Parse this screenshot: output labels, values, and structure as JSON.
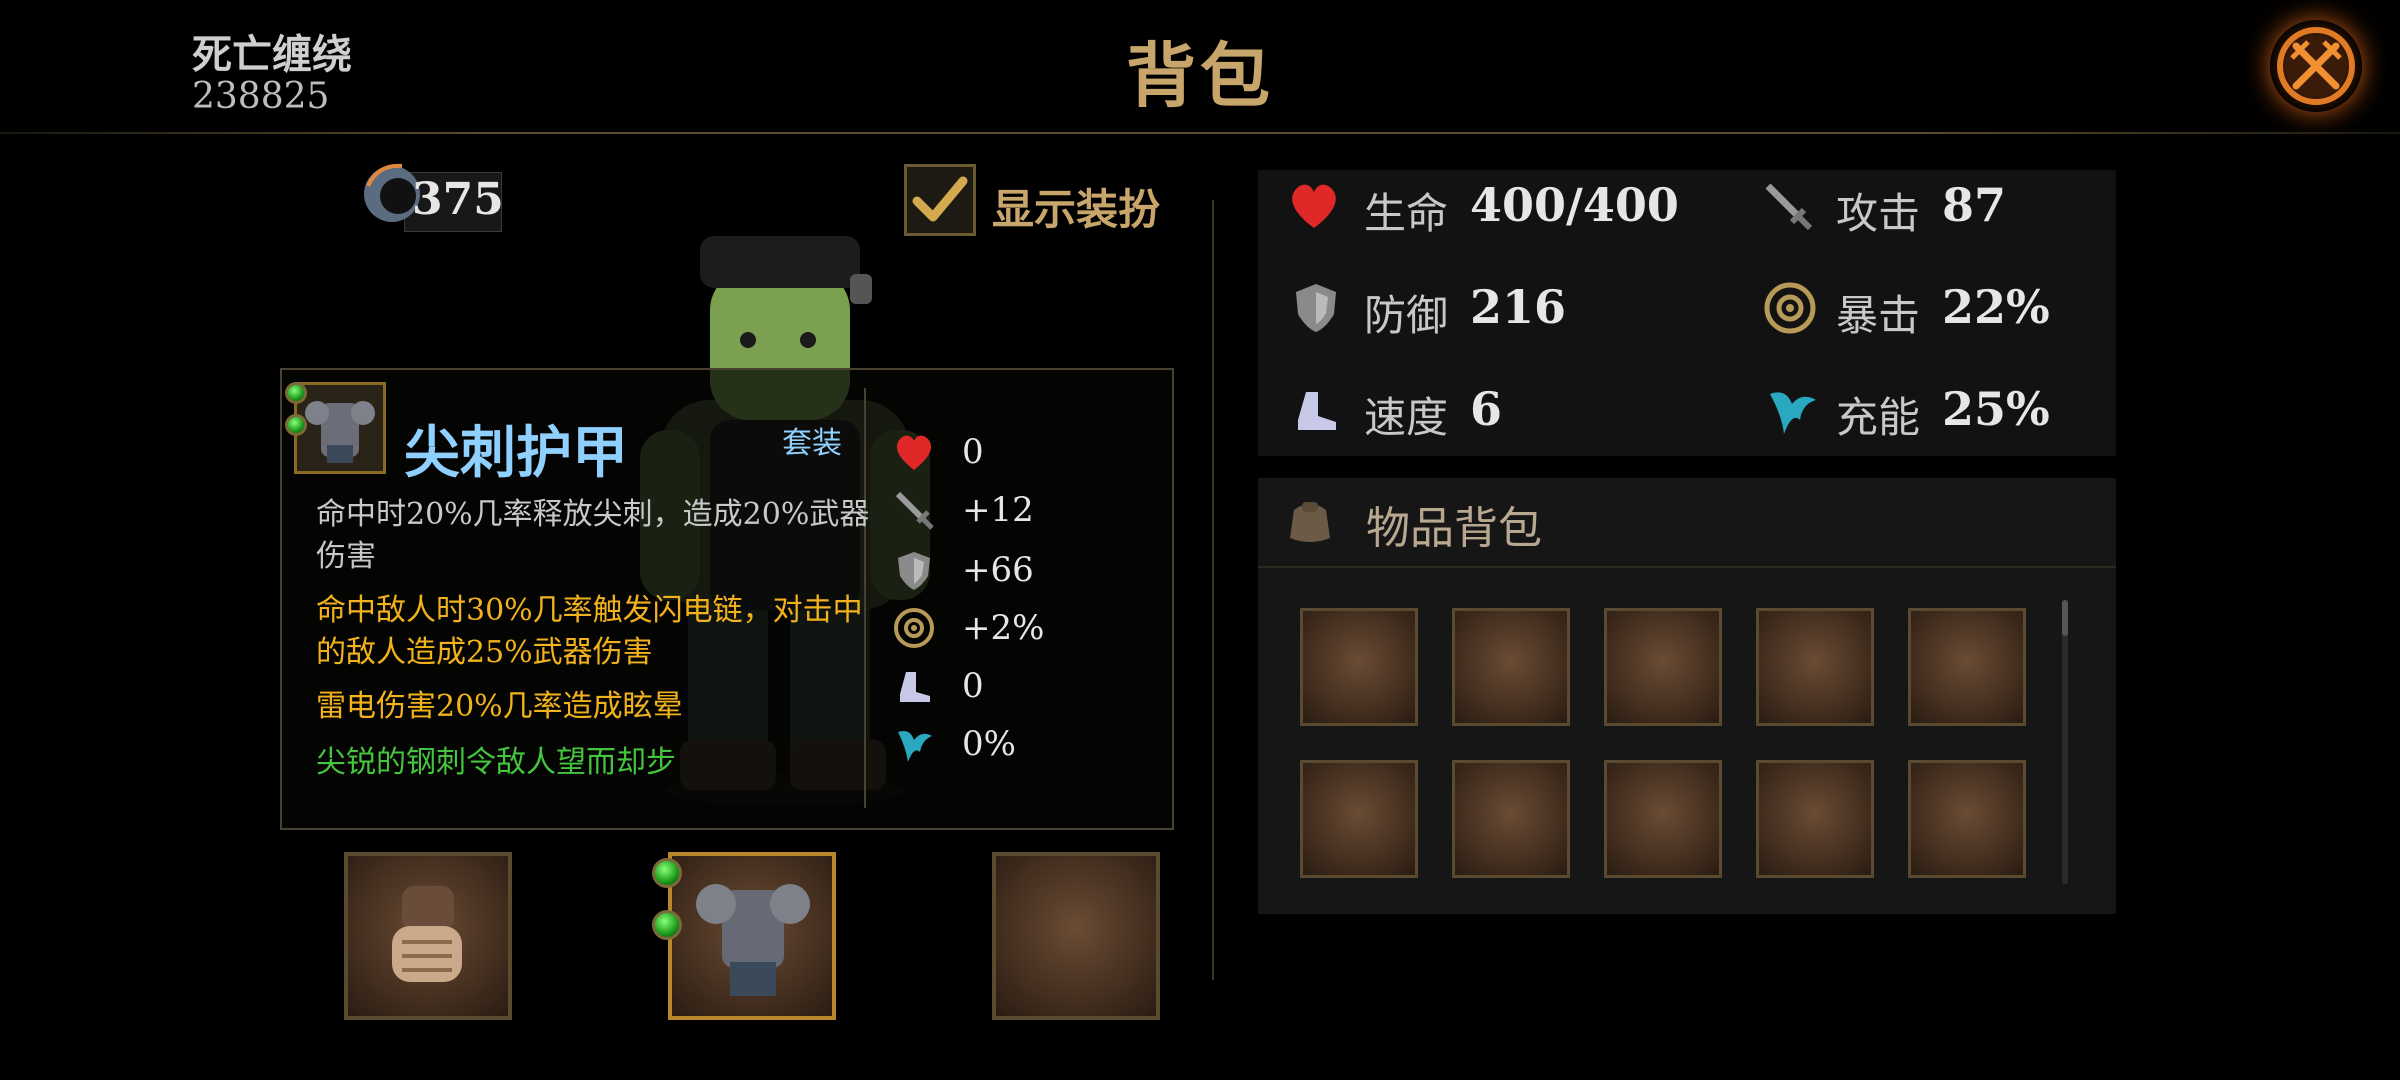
{
  "header": {
    "player_name": "死亡缠绕",
    "player_id": "238825",
    "title": "背包",
    "close_icon": "crossed-swords-close-icon"
  },
  "currency": {
    "icon": "moonstone-icon",
    "value": "375"
  },
  "outfit_toggle": {
    "label": "显示装扮",
    "checked": true
  },
  "tooltip": {
    "item_name": "尖刺护甲",
    "tag": "套装",
    "descriptions": [
      "命中时20%几率释放尖刺，造成20%武器伤害",
      "命中敌人时30%几率触发闪电链，对击中的敌人造成25%武器伤害",
      "雷电伤害20%几率造成眩晕",
      "尖锐的钢刺令敌人望而却步"
    ],
    "stats": [
      {
        "icon": "heart-icon",
        "value": "0"
      },
      {
        "icon": "sword-icon",
        "value": "+12"
      },
      {
        "icon": "shield-icon",
        "value": "+66"
      },
      {
        "icon": "crit-target-icon",
        "value": "+2%"
      },
      {
        "icon": "boot-icon",
        "value": "0"
      },
      {
        "icon": "energy-swirl-icon",
        "value": "0%"
      }
    ]
  },
  "equipment": [
    {
      "name": "gloves",
      "gems": 0
    },
    {
      "name": "armor",
      "gems": 2
    },
    {
      "name": "empty",
      "gems": 0
    }
  ],
  "stats": {
    "hp": {
      "label": "生命",
      "value": "400/400"
    },
    "attack": {
      "label": "攻击",
      "value": "87"
    },
    "defense": {
      "label": "防御",
      "value": "216"
    },
    "crit": {
      "label": "暴击",
      "value": "22%"
    },
    "speed": {
      "label": "速度",
      "value": "6"
    },
    "charge": {
      "label": "充能",
      "value": "25%"
    }
  },
  "bag": {
    "title": "物品背包",
    "slots": 10
  },
  "colors": {
    "gold": "#c8a56a",
    "item_name": "#8fd0ff",
    "effect_orange": "#f2b21c",
    "flavor_green": "#45c43e"
  }
}
